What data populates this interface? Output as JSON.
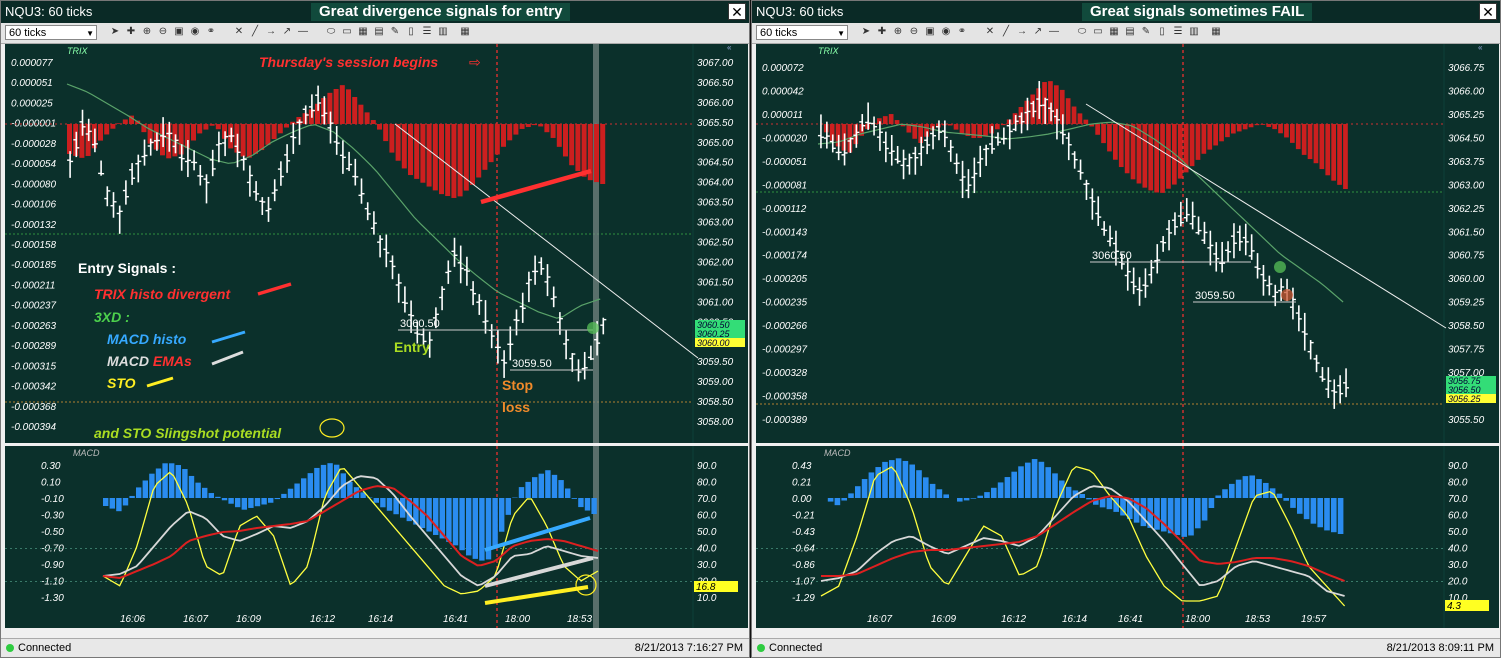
{
  "left": {
    "window_title": "NQU3: 60 ticks",
    "headline": "Great divergence  signals for entry",
    "interval": "60 ticks",
    "trix_label": "TRIX",
    "macd_label": "MACD",
    "trix_axis": [
      "0.000077",
      "0.000051",
      "0.000025",
      "-0.000001",
      "-0.000028",
      "-0.000054",
      "-0.000080",
      "-0.000106",
      "-0.000132",
      "-0.000158",
      "-0.000185",
      "-0.000211",
      "-0.000237",
      "-0.000263",
      "-0.000289",
      "-0.000315",
      "-0.000342",
      "-0.000368",
      "-0.000394"
    ],
    "price_axis": [
      "3067.00",
      "3066.50",
      "3066.00",
      "3065.50",
      "3065.00",
      "3064.50",
      "3064.00",
      "3063.50",
      "3063.00",
      "3062.50",
      "3062.00",
      "3061.50",
      "3061.00",
      "3060.50",
      "3060.00",
      "3059.50",
      "3059.00",
      "3058.50",
      "3058.00"
    ],
    "price_tags": [
      "3060.50",
      "3060.25",
      "3060.00"
    ],
    "macd_axis": [
      "0.30",
      "0.10",
      "-0.10",
      "-0.30",
      "-0.50",
      "-0.70",
      "-0.90",
      "-1.10",
      "-1.30"
    ],
    "sto_axis": [
      "90.0",
      "80.0",
      "70.0",
      "60.0",
      "50.0",
      "40.0",
      "30.0",
      "20.0",
      "10.0"
    ],
    "sto_tag": "16.8",
    "time_axis": [
      "16:06",
      "16:07",
      "16:09",
      "16:12",
      "16:14",
      "16:41",
      "18:00",
      "18:53"
    ],
    "price_marks": [
      "3060.50",
      "3059.50"
    ],
    "annotations": {
      "session": "Thursday's session begins",
      "entry_signals": "Entry Signals :",
      "trix_div": "TRIX histo divergent",
      "threexd": "3XD :",
      "macd_histo": "MACD histo",
      "macd_emas_1": "MACD ",
      "macd_emas_2": "EMAs",
      "sto": "STO",
      "slingshot": "and STO Slingshot potential",
      "entry": "Entry",
      "stop": "Stop",
      "loss": "loss"
    },
    "status": "Connected",
    "datetime": "8/21/2013 7:16:27 PM"
  },
  "right": {
    "window_title": "NQU3: 60 ticks",
    "headline": "Great signals sometimes FAIL",
    "interval": "60 ticks",
    "trix_label": "TRIX",
    "macd_label": "MACD",
    "trix_axis": [
      "0.000072",
      "0.000042",
      "0.000011",
      "-0.000020",
      "-0.000051",
      "-0.000081",
      "-0.000112",
      "-0.000143",
      "-0.000174",
      "-0.000205",
      "-0.000235",
      "-0.000266",
      "-0.000297",
      "-0.000328",
      "-0.000358",
      "-0.000389"
    ],
    "price_axis": [
      "3066.75",
      "3066.00",
      "3065.25",
      "3064.50",
      "3063.75",
      "3063.00",
      "3062.25",
      "3061.50",
      "3060.75",
      "3060.00",
      "3059.25",
      "3058.50",
      "3057.75",
      "3057.00",
      "3056.25",
      "3055.50"
    ],
    "price_tags": [
      "3056.75",
      "3056.50",
      "3056.25"
    ],
    "macd_axis": [
      "0.43",
      "0.21",
      "0.00",
      "-0.21",
      "-0.43",
      "-0.64",
      "-0.86",
      "-1.07",
      "-1.29"
    ],
    "sto_axis": [
      "90.0",
      "80.0",
      "70.0",
      "60.0",
      "50.0",
      "40.0",
      "30.0",
      "20.0",
      "10.0"
    ],
    "sto_tag": "4.3",
    "time_axis": [
      "16:07",
      "16:09",
      "16:12",
      "16:14",
      "16:41",
      "18:00",
      "18:53",
      "19:57"
    ],
    "price_marks": [
      "3060.50",
      "3059.50"
    ],
    "status": "Connected",
    "datetime": "8/21/2013 8:09:11 PM"
  },
  "colors": {
    "pane_bg": "#0b302b",
    "trix_histo": "#cc1f1f",
    "macd_histo": "#2a8cf0",
    "price_bars": "#ffffff",
    "sto_line": "#ffff40",
    "macd_signal": "#dd2020",
    "macd_line": "#d8d8d8",
    "trix_avg": "#5aa36a",
    "annot_red": "#ff3030",
    "annot_green": "#4cd04c",
    "annot_blue": "#36a9ff",
    "annot_yellow": "#ffee22"
  }
}
